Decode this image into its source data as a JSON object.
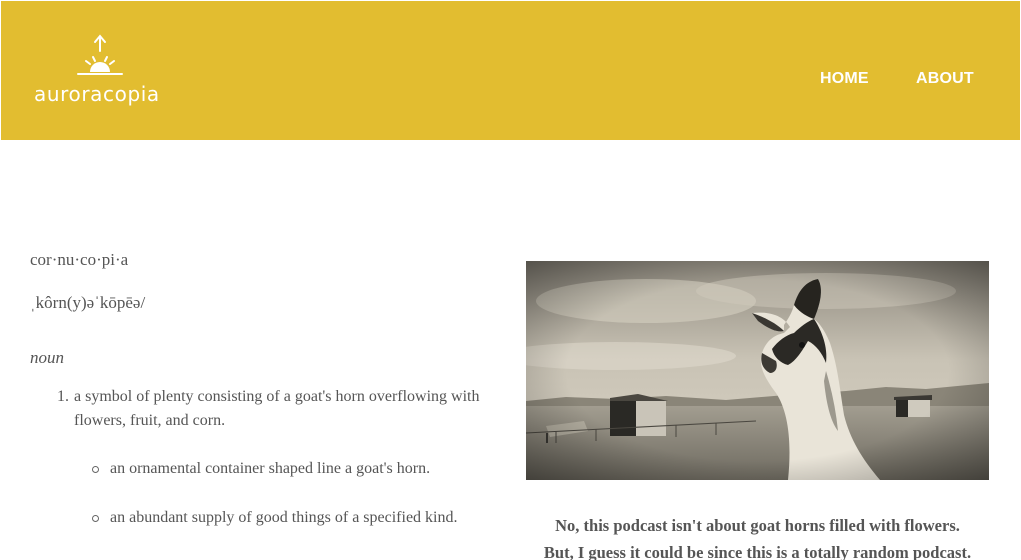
{
  "brand": {
    "name": "auroracopia",
    "background_color": "#e2bd30",
    "logo_icon": "sunrise-arrow-icon"
  },
  "nav": {
    "items": [
      {
        "label": "HOME"
      },
      {
        "label": "ABOUT"
      }
    ]
  },
  "definition": {
    "word": "cor·nu·co·pi·a",
    "pronunciation": "ˌkôrn(y)əˈkōpēə/",
    "part_of_speech": "noun",
    "senses": [
      {
        "number": "1.",
        "text": "a symbol of plenty consisting of a goat's horn overflowing with flowers, fruit, and corn.",
        "subsenses": [
          "an ornamental container shaped line a goat's horn.",
          "an abundant supply of good things of a specified kind."
        ]
      }
    ]
  },
  "photo": {
    "subject": "goat-photo"
  },
  "caption": {
    "line1": "No, this podcast isn't about goat horns filled with flowers.",
    "line2": "But, I guess it could be since this is a totally random podcast."
  }
}
